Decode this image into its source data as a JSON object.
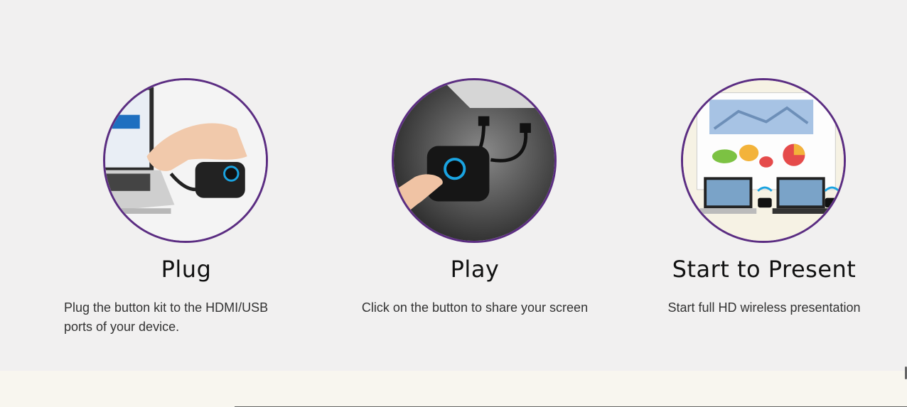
{
  "steps": [
    {
      "title": "Plug",
      "description": "Plug the button kit to the HDMI/USB ports of your device.",
      "image_icon": "laptop-plug-in-image"
    },
    {
      "title": "Play",
      "description": "Click on the button to share your screen",
      "image_icon": "button-press-image"
    },
    {
      "title": "Start to Present",
      "description": "Start full HD wireless presentation",
      "image_icon": "projection-screen-image"
    }
  ],
  "colors": {
    "background": "#f1f0f0",
    "circle_border": "#5b2d82",
    "title_text": "#111111",
    "body_text": "#333333",
    "footer_band": "#f8f6ef",
    "button_ring": "#1aa3e0"
  }
}
